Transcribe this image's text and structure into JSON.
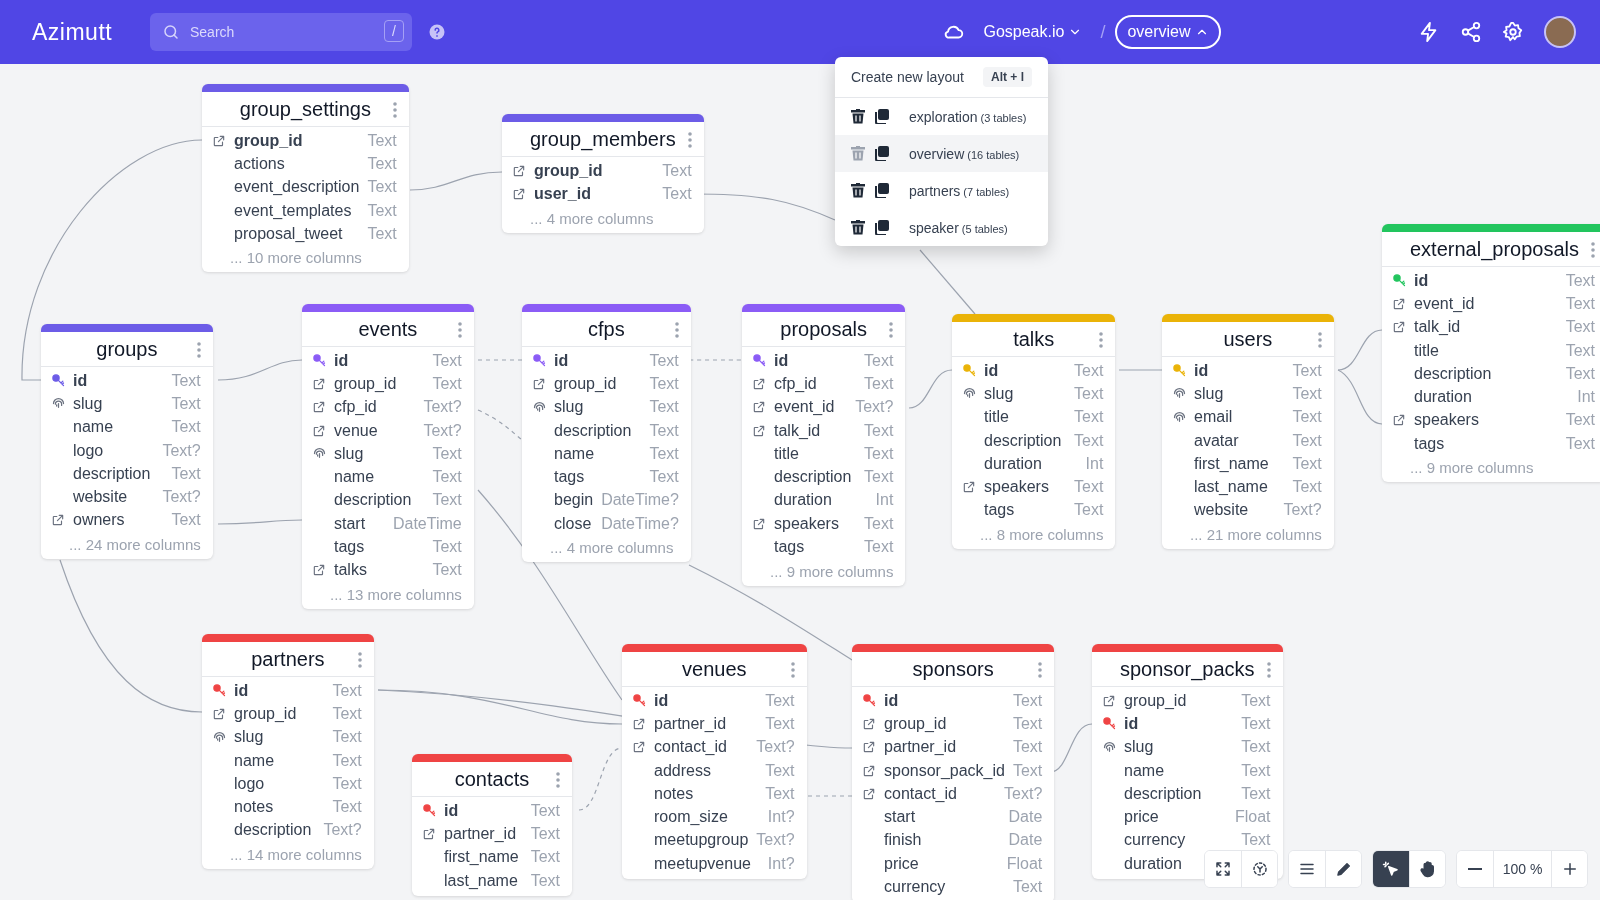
{
  "header": {
    "logo": "Azimutt",
    "search": {
      "placeholder": "Search",
      "shortcut": "/"
    },
    "project": "Gospeak.io",
    "separator": "/",
    "layout": "overview"
  },
  "layout_menu": {
    "create": "Create new layout",
    "create_shortcut": "Alt + l",
    "items": [
      {
        "name": "exploration",
        "count": "(3 tables)",
        "selected": false
      },
      {
        "name": "overview",
        "count": "(16 tables)",
        "selected": true
      },
      {
        "name": "partners",
        "count": "(7 tables)",
        "selected": false
      },
      {
        "name": "speaker",
        "count": "(5 tables)",
        "selected": false
      }
    ]
  },
  "tables": [
    {
      "name": "group_settings",
      "color": "#6c5ce7",
      "more": "... 10 more columns",
      "columns": [
        {
          "name": "group_id",
          "type": "Text",
          "kind": "foreign",
          "primary": true
        },
        {
          "name": "actions",
          "type": "Text",
          "kind": "plain",
          "primary": false
        },
        {
          "name": "event_description",
          "type": "Text",
          "kind": "plain",
          "primary": false
        },
        {
          "name": "event_templates",
          "type": "Text",
          "kind": "plain",
          "primary": false
        },
        {
          "name": "proposal_tweet",
          "type": "Text",
          "kind": "plain",
          "primary": false
        }
      ]
    },
    {
      "name": "group_members",
      "color": "#6c5ce7",
      "more": "... 4 more columns",
      "columns": [
        {
          "name": "group_id",
          "type": "Text",
          "kind": "foreign",
          "primary": true
        },
        {
          "name": "user_id",
          "type": "Text",
          "kind": "foreign",
          "primary": true
        }
      ]
    },
    {
      "name": "groups",
      "color": "#6c5ce7",
      "more": "... 24 more columns",
      "columns": [
        {
          "name": "id",
          "type": "Text",
          "kind": "primary",
          "primary": true
        },
        {
          "name": "slug",
          "type": "Text",
          "kind": "unique",
          "primary": false
        },
        {
          "name": "name",
          "type": "Text",
          "kind": "plain",
          "primary": false
        },
        {
          "name": "logo",
          "type": "Text?",
          "kind": "plain",
          "primary": false
        },
        {
          "name": "description",
          "type": "Text",
          "kind": "plain",
          "primary": false
        },
        {
          "name": "website",
          "type": "Text?",
          "kind": "plain",
          "primary": false
        },
        {
          "name": "owners",
          "type": "Text",
          "kind": "foreign",
          "primary": false
        }
      ]
    },
    {
      "name": "events",
      "color": "#8b5cf6",
      "more": "... 13 more columns",
      "columns": [
        {
          "name": "id",
          "type": "Text",
          "kind": "primary",
          "primary": true
        },
        {
          "name": "group_id",
          "type": "Text",
          "kind": "foreign",
          "primary": false
        },
        {
          "name": "cfp_id",
          "type": "Text?",
          "kind": "foreign",
          "primary": false
        },
        {
          "name": "venue",
          "type": "Text?",
          "kind": "foreign",
          "primary": false
        },
        {
          "name": "slug",
          "type": "Text",
          "kind": "unique",
          "primary": false
        },
        {
          "name": "name",
          "type": "Text",
          "kind": "plain",
          "primary": false
        },
        {
          "name": "description",
          "type": "Text",
          "kind": "plain",
          "primary": false
        },
        {
          "name": "start",
          "type": "DateTime",
          "kind": "plain",
          "primary": false
        },
        {
          "name": "tags",
          "type": "Text",
          "kind": "plain",
          "primary": false
        },
        {
          "name": "talks",
          "type": "Text",
          "kind": "foreign",
          "primary": false
        }
      ]
    },
    {
      "name": "cfps",
      "color": "#8b5cf6",
      "more": "... 4 more columns",
      "columns": [
        {
          "name": "id",
          "type": "Text",
          "kind": "primary",
          "primary": true
        },
        {
          "name": "group_id",
          "type": "Text",
          "kind": "foreign",
          "primary": false
        },
        {
          "name": "slug",
          "type": "Text",
          "kind": "unique",
          "primary": false
        },
        {
          "name": "description",
          "type": "Text",
          "kind": "plain",
          "primary": false
        },
        {
          "name": "name",
          "type": "Text",
          "kind": "plain",
          "primary": false
        },
        {
          "name": "tags",
          "type": "Text",
          "kind": "plain",
          "primary": false
        },
        {
          "name": "begin",
          "type": "DateTime?",
          "kind": "plain",
          "primary": false
        },
        {
          "name": "close",
          "type": "DateTime?",
          "kind": "plain",
          "primary": false
        }
      ]
    },
    {
      "name": "proposals",
      "color": "#8b5cf6",
      "more": "... 9 more columns",
      "columns": [
        {
          "name": "id",
          "type": "Text",
          "kind": "primary",
          "primary": true
        },
        {
          "name": "cfp_id",
          "type": "Text",
          "kind": "foreign",
          "primary": false
        },
        {
          "name": "event_id",
          "type": "Text?",
          "kind": "foreign",
          "primary": false
        },
        {
          "name": "talk_id",
          "type": "Text",
          "kind": "foreign",
          "primary": false
        },
        {
          "name": "title",
          "type": "Text",
          "kind": "plain",
          "primary": false
        },
        {
          "name": "description",
          "type": "Text",
          "kind": "plain",
          "primary": false
        },
        {
          "name": "duration",
          "type": "Int",
          "kind": "plain",
          "primary": false
        },
        {
          "name": "speakers",
          "type": "Text",
          "kind": "foreign",
          "primary": false
        },
        {
          "name": "tags",
          "type": "Text",
          "kind": "plain",
          "primary": false
        }
      ]
    },
    {
      "name": "talks",
      "color": "#eab308",
      "more": "... 8 more columns",
      "columns": [
        {
          "name": "id",
          "type": "Text",
          "kind": "primary",
          "primary": true
        },
        {
          "name": "slug",
          "type": "Text",
          "kind": "unique",
          "primary": false
        },
        {
          "name": "title",
          "type": "Text",
          "kind": "plain",
          "primary": false
        },
        {
          "name": "description",
          "type": "Text",
          "kind": "plain",
          "primary": false
        },
        {
          "name": "duration",
          "type": "Int",
          "kind": "plain",
          "primary": false
        },
        {
          "name": "speakers",
          "type": "Text",
          "kind": "foreign",
          "primary": false
        },
        {
          "name": "tags",
          "type": "Text",
          "kind": "plain",
          "primary": false
        }
      ]
    },
    {
      "name": "users",
      "color": "#eab308",
      "more": "... 21 more columns",
      "columns": [
        {
          "name": "id",
          "type": "Text",
          "kind": "primary",
          "primary": true
        },
        {
          "name": "slug",
          "type": "Text",
          "kind": "unique",
          "primary": false
        },
        {
          "name": "email",
          "type": "Text",
          "kind": "unique",
          "primary": false
        },
        {
          "name": "avatar",
          "type": "Text",
          "kind": "plain",
          "primary": false
        },
        {
          "name": "first_name",
          "type": "Text",
          "kind": "plain",
          "primary": false
        },
        {
          "name": "last_name",
          "type": "Text",
          "kind": "plain",
          "primary": false
        },
        {
          "name": "website",
          "type": "Text?",
          "kind": "plain",
          "primary": false
        }
      ]
    },
    {
      "name": "external_proposals",
      "color": "#22c55e",
      "more": "... 9 more columns",
      "columns": [
        {
          "name": "id",
          "type": "Text",
          "kind": "primary",
          "primary": true
        },
        {
          "name": "event_id",
          "type": "Text",
          "kind": "foreign",
          "primary": false
        },
        {
          "name": "talk_id",
          "type": "Text",
          "kind": "foreign",
          "primary": false
        },
        {
          "name": "title",
          "type": "Text",
          "kind": "plain",
          "primary": false
        },
        {
          "name": "description",
          "type": "Text",
          "kind": "plain",
          "primary": false
        },
        {
          "name": "duration",
          "type": "Int",
          "kind": "plain",
          "primary": false
        },
        {
          "name": "speakers",
          "type": "Text",
          "kind": "foreign",
          "primary": false
        },
        {
          "name": "tags",
          "type": "Text",
          "kind": "plain",
          "primary": false
        }
      ]
    },
    {
      "name": "partners",
      "color": "#ef4444",
      "more": "... 14 more columns",
      "columns": [
        {
          "name": "id",
          "type": "Text",
          "kind": "primary",
          "primary": true
        },
        {
          "name": "group_id",
          "type": "Text",
          "kind": "foreign",
          "primary": false
        },
        {
          "name": "slug",
          "type": "Text",
          "kind": "unique",
          "primary": false
        },
        {
          "name": "name",
          "type": "Text",
          "kind": "plain",
          "primary": false
        },
        {
          "name": "logo",
          "type": "Text",
          "kind": "plain",
          "primary": false
        },
        {
          "name": "notes",
          "type": "Text",
          "kind": "plain",
          "primary": false
        },
        {
          "name": "description",
          "type": "Text?",
          "kind": "plain",
          "primary": false
        }
      ]
    },
    {
      "name": "contacts",
      "color": "#ef4444",
      "columns": [
        {
          "name": "id",
          "type": "Text",
          "kind": "primary",
          "primary": true
        },
        {
          "name": "partner_id",
          "type": "Text",
          "kind": "foreign",
          "primary": false
        },
        {
          "name": "first_name",
          "type": "Text",
          "kind": "plain",
          "primary": false
        },
        {
          "name": "last_name",
          "type": "Text",
          "kind": "plain",
          "primary": false
        }
      ]
    },
    {
      "name": "venues",
      "color": "#ef4444",
      "columns": [
        {
          "name": "id",
          "type": "Text",
          "kind": "primary",
          "primary": true
        },
        {
          "name": "partner_id",
          "type": "Text",
          "kind": "foreign",
          "primary": false
        },
        {
          "name": "contact_id",
          "type": "Text?",
          "kind": "foreign",
          "primary": false
        },
        {
          "name": "address",
          "type": "Text",
          "kind": "plain",
          "primary": false
        },
        {
          "name": "notes",
          "type": "Text",
          "kind": "plain",
          "primary": false
        },
        {
          "name": "room_size",
          "type": "Int?",
          "kind": "plain",
          "primary": false
        },
        {
          "name": "meetupgroup",
          "type": "Text?",
          "kind": "plain",
          "primary": false
        },
        {
          "name": "meetupvenue",
          "type": "Int?",
          "kind": "plain",
          "primary": false
        }
      ]
    },
    {
      "name": "sponsors",
      "color": "#ef4444",
      "columns": [
        {
          "name": "id",
          "type": "Text",
          "kind": "primary",
          "primary": true
        },
        {
          "name": "group_id",
          "type": "Text",
          "kind": "foreign",
          "primary": false
        },
        {
          "name": "partner_id",
          "type": "Text",
          "kind": "foreign",
          "primary": false
        },
        {
          "name": "sponsor_pack_id",
          "type": "Text",
          "kind": "foreign",
          "primary": false
        },
        {
          "name": "contact_id",
          "type": "Text?",
          "kind": "foreign",
          "primary": false
        },
        {
          "name": "start",
          "type": "Date",
          "kind": "plain",
          "primary": false
        },
        {
          "name": "finish",
          "type": "Date",
          "kind": "plain",
          "primary": false
        },
        {
          "name": "price",
          "type": "Float",
          "kind": "plain",
          "primary": false
        },
        {
          "name": "currency",
          "type": "Text",
          "kind": "plain",
          "primary": false
        }
      ]
    },
    {
      "name": "sponsor_packs",
      "color": "#ef4444",
      "columns": [
        {
          "name": "group_id",
          "type": "Text",
          "kind": "foreign",
          "primary": false
        },
        {
          "name": "id",
          "type": "Text",
          "kind": "primary",
          "primary": true
        },
        {
          "name": "slug",
          "type": "Text",
          "kind": "unique",
          "primary": false
        },
        {
          "name": "name",
          "type": "Text",
          "kind": "plain",
          "primary": false
        },
        {
          "name": "description",
          "type": "Text",
          "kind": "plain",
          "primary": false
        },
        {
          "name": "price",
          "type": "Float",
          "kind": "plain",
          "primary": false
        },
        {
          "name": "currency",
          "type": "Text",
          "kind": "plain",
          "primary": false
        },
        {
          "name": "duration",
          "kind": "plain",
          "primary": false
        }
      ]
    }
  ],
  "toolbar": {
    "modes": [
      {
        "selected": true
      },
      {
        "selected": false
      }
    ],
    "zoom": "100 %"
  }
}
